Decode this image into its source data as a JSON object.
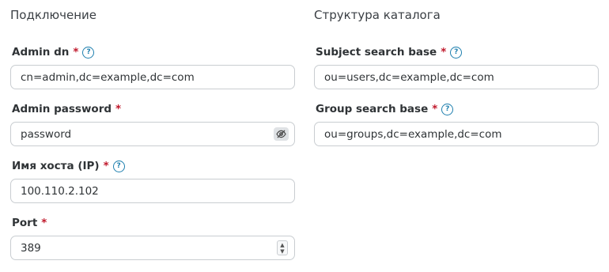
{
  "connection": {
    "title": "Подключение",
    "admin_dn": {
      "label": "Admin dn",
      "required": "*",
      "value": "cn=admin,dc=example,dc=com",
      "help_icon": "help-circle-icon"
    },
    "admin_password": {
      "label": "Admin password",
      "required": "*",
      "value": "password",
      "toggle_icon": "eye-off-icon"
    },
    "host": {
      "label": "Имя хоста (IP)",
      "required": "*",
      "value": "100.110.2.102",
      "help_icon": "help-circle-icon"
    },
    "port": {
      "label": "Port",
      "required": "*",
      "value": "389",
      "stepper_icon": "stepper-icon"
    }
  },
  "directory": {
    "title": "Структура каталога",
    "subject_search_base": {
      "label": "Subject search base",
      "required": "*",
      "value": "ou=users,dc=example,dc=com",
      "help_icon": "help-circle-icon"
    },
    "group_search_base": {
      "label": "Group search base",
      "required": "*",
      "value": "ou=groups,dc=example,dc=com",
      "help_icon": "help-circle-icon"
    }
  },
  "colors": {
    "required_marker": "#c0182b",
    "help_icon": "#1e7fae",
    "input_border": "#c9cdd1"
  }
}
